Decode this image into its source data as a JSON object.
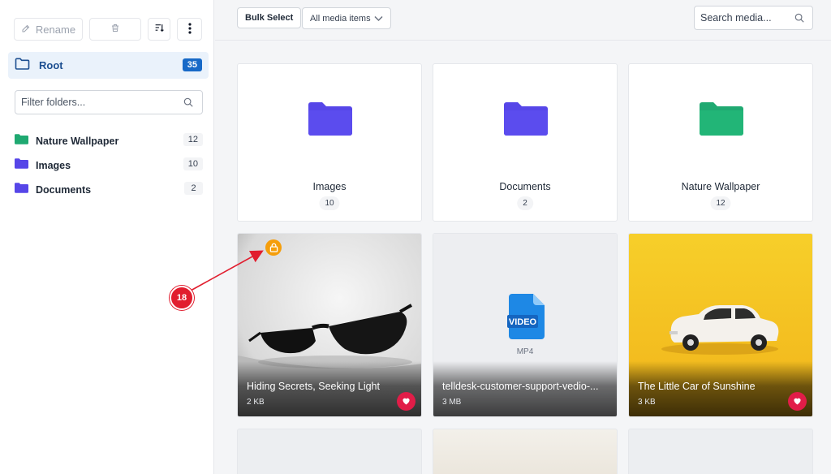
{
  "sidebar": {
    "toolbar": {
      "rename_label": "Rename",
      "rename_icon": "edit-icon",
      "delete_icon": "trash-icon",
      "sort_icon": "sort-icon",
      "more_icon": "more-vertical-icon"
    },
    "root": {
      "label": "Root",
      "count": "35"
    },
    "filter": {
      "placeholder": "Filter folders..."
    },
    "folders": [
      {
        "name": "Nature Wallpaper",
        "count": "12",
        "color": "#1fa971"
      },
      {
        "name": "Images",
        "count": "10",
        "color": "#5646e8"
      },
      {
        "name": "Documents",
        "count": "2",
        "color": "#5646e8"
      }
    ]
  },
  "topbar": {
    "bulk_select_label": "Bulk Select",
    "media_filter_value": "All media items",
    "search_placeholder": "Search media..."
  },
  "grid": {
    "folders": [
      {
        "name": "Images",
        "count": "10",
        "color": "#5646e8"
      },
      {
        "name": "Documents",
        "count": "2",
        "color": "#5646e8"
      },
      {
        "name": "Nature Wallpaper",
        "count": "12",
        "color": "#1fa971"
      }
    ],
    "media": [
      {
        "title": "Hiding Secrets, Seeking Light",
        "size": "2 KB",
        "locked": true,
        "favorite": true
      },
      {
        "title": "telldesk-customer-support-vedio-...",
        "size": "3 MB",
        "type_badge": "VIDEO",
        "ext": "MP4",
        "favorite": false
      },
      {
        "title": "The Little Car of Sunshine",
        "size": "3 KB",
        "favorite": true
      }
    ]
  },
  "annotation": {
    "number": "18"
  },
  "colors": {
    "accent": "#1769c7",
    "favorite": "#e11d48",
    "lock": "#f59e0b",
    "callout": "#e11d2e"
  }
}
